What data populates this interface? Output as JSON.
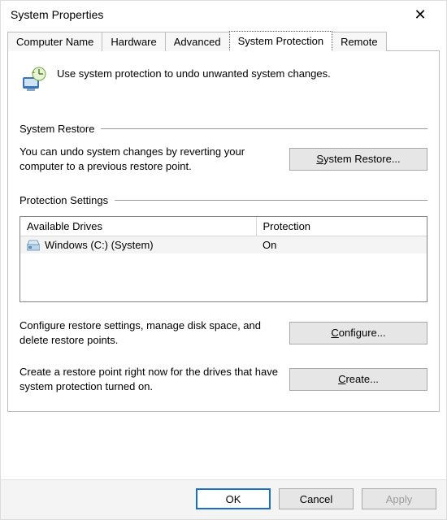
{
  "window": {
    "title": "System Properties"
  },
  "tabs": [
    {
      "label": "Computer Name"
    },
    {
      "label": "Hardware"
    },
    {
      "label": "Advanced"
    },
    {
      "label": "System Protection",
      "active": true
    },
    {
      "label": "Remote"
    }
  ],
  "intro": {
    "text": "Use system protection to undo unwanted system changes."
  },
  "system_restore": {
    "group_label": "System Restore",
    "description": "You can undo system changes by reverting your computer to a previous restore point.",
    "button_prefix": "S",
    "button_rest": "ystem Restore...",
    "button_full": "System Restore..."
  },
  "protection_settings": {
    "group_label": "Protection Settings",
    "columns": {
      "drives": "Available Drives",
      "protection": "Protection"
    },
    "rows": [
      {
        "drive": "Windows (C:) (System)",
        "protection": "On"
      }
    ],
    "configure": {
      "description": "Configure restore settings, manage disk space, and delete restore points.",
      "button_prefix": "C",
      "button_rest": "onfigure...",
      "button_full": "Configure..."
    },
    "create": {
      "description": "Create a restore point right now for the drives that have system protection turned on.",
      "button_prefix": "C",
      "button_rest": "reate...",
      "button_full": "Create..."
    }
  },
  "dialog_buttons": {
    "ok": "OK",
    "cancel": "Cancel",
    "apply": "Apply"
  }
}
